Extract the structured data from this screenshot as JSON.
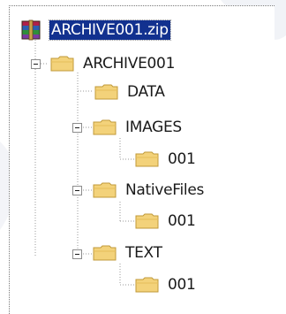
{
  "tree": {
    "root": {
      "label": "ARCHIVE001.zip",
      "icon": "winrar-archive-icon",
      "selected": true
    },
    "archive": {
      "label": "ARCHIVE001",
      "expanded": true
    },
    "data": {
      "label": "DATA"
    },
    "images": {
      "label": "IMAGES",
      "expanded": true
    },
    "images_001": {
      "label": "001"
    },
    "native": {
      "label": "NativeFiles",
      "expanded": true
    },
    "native_001": {
      "label": "001"
    },
    "text": {
      "label": "TEXT",
      "expanded": true
    },
    "text_001": {
      "label": "001"
    }
  },
  "colors": {
    "selection": "#12318f",
    "folder": "#f3d27a",
    "folder_edge": "#c09a3a"
  }
}
